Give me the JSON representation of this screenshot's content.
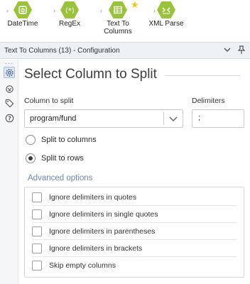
{
  "palette": {
    "tools": [
      {
        "label_lines": [
          "DateTime"
        ],
        "icon": "calendar-clock-icon"
      },
      {
        "label_lines": [
          "RegEx"
        ],
        "icon": "regex-icon"
      },
      {
        "label_lines": [
          "Text To",
          "Columns"
        ],
        "icon": "text-to-columns-icon"
      },
      {
        "label_lines": [
          "XML Parse"
        ],
        "icon": "xml-parse-icon"
      }
    ],
    "favorite_icon": "star-icon",
    "colors": {
      "tool_green": "#9ac23c",
      "star": "#f2c511"
    }
  },
  "config_bar": {
    "title": "Text To Columns (13) - Configuration",
    "collapse_icon": "chevron-down-icon",
    "pin_icon": "pin-icon"
  },
  "rail": {
    "more_icon": "ellipsis-icon",
    "items": [
      "gear-icon",
      "connection-icon",
      "tag-icon",
      "help-icon"
    ]
  },
  "main": {
    "heading": "Select Column to Split",
    "column_label": "Column to split",
    "column_value": "program/fund",
    "delimiters_label": "Delimiters",
    "delimiters_value": ";",
    "radios": [
      {
        "label": "Split to columns",
        "selected": false
      },
      {
        "label": "Split to rows",
        "selected": true
      }
    ],
    "advanced_title": "Advanced options",
    "advanced_options": [
      "Ignore delimiters in quotes",
      "Ignore delimiters in single quotes",
      "Ignore delimiters in parentheses",
      "Ignore delimiters in brackets",
      "Skip empty columns"
    ],
    "accent_color": "#6f86aa"
  }
}
